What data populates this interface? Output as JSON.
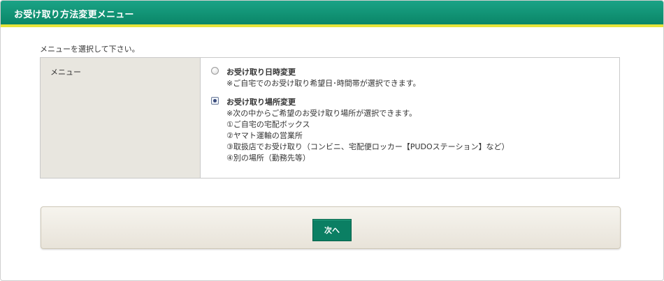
{
  "header": {
    "title": "お受け取り方法変更メニュー"
  },
  "instruction": "メニューを選択して下さい。",
  "menu": {
    "label": "メニュー",
    "options": [
      {
        "title": "お受け取り日時変更",
        "checked": false,
        "lines": [
          "※ご自宅でのお受け取り希望日･時間帯が選択できます。"
        ]
      },
      {
        "title": "お受け取り場所変更",
        "checked": true,
        "lines": [
          "※次の中からご希望のお受け取り場所が選択できます。",
          "①ご自宅の宅配ボックス",
          "②ヤマト運輸の営業所",
          "③取扱店でお受け取り（コンビニ、宅配便ロッカー【PUDOステーション】など）",
          "④別の場所（勤務先等）"
        ]
      }
    ]
  },
  "footer": {
    "next_label": "次へ"
  },
  "colors": {
    "header_green": "#0b8667",
    "header_border": "#e7e43a",
    "button_green": "#0b7f63"
  }
}
